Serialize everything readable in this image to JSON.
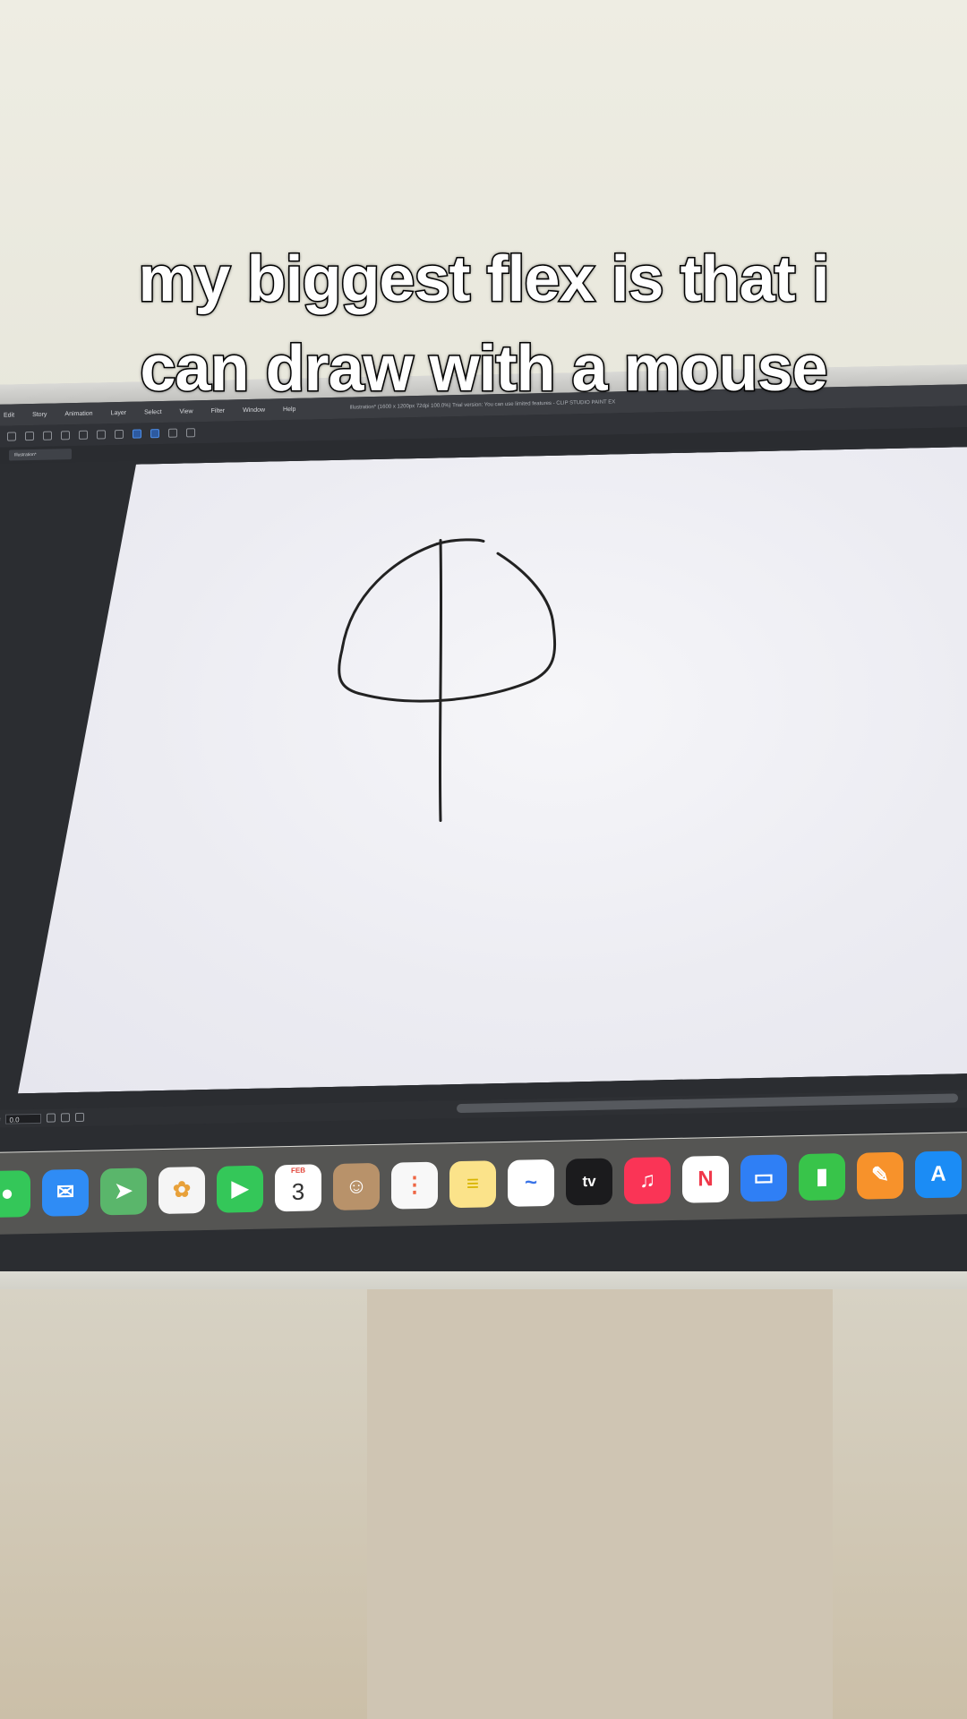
{
  "caption": {
    "line1": "my biggest flex is that i",
    "line2": "can draw with a mouse"
  },
  "app_window": {
    "menu": [
      "Edit",
      "Story",
      "Animation",
      "Layer",
      "Select",
      "View",
      "Filter",
      "Window",
      "Help"
    ],
    "title": "Illustration* (1600 x 1200px 72dpi 100.0%) Trial version: You can use limited features - CLIP STUDIO PAINT EX",
    "tab_label": "Illustration*",
    "zoom_value": "0.0",
    "canvas_drawing": "hand-drawn circle with a vertical line through it"
  },
  "dock": {
    "apps": [
      {
        "name": "messages",
        "color": "#34c759"
      },
      {
        "name": "mail",
        "color": "#2f8cf5"
      },
      {
        "name": "maps",
        "color": "#5ab66b"
      },
      {
        "name": "photos",
        "color": "#f5f5f5"
      },
      {
        "name": "facetime",
        "color": "#34c759"
      },
      {
        "name": "calendar",
        "color": "#ffffff",
        "month": "FEB",
        "day": "3"
      },
      {
        "name": "contacts",
        "color": "#b8926a"
      },
      {
        "name": "reminders",
        "color": "#f8f8f8"
      },
      {
        "name": "notes",
        "color": "#fbe38a"
      },
      {
        "name": "freeform",
        "color": "#ffffff"
      },
      {
        "name": "apple-tv",
        "color": "#1b1b1d",
        "label": "tv"
      },
      {
        "name": "music",
        "color": "#fa3456"
      },
      {
        "name": "news",
        "color": "#ffffff"
      },
      {
        "name": "keynote",
        "color": "#2f7ff5"
      },
      {
        "name": "numbers",
        "color": "#38c44a"
      },
      {
        "name": "pages",
        "color": "#f7922b"
      },
      {
        "name": "app-store",
        "color": "#1b8cf5"
      }
    ]
  }
}
